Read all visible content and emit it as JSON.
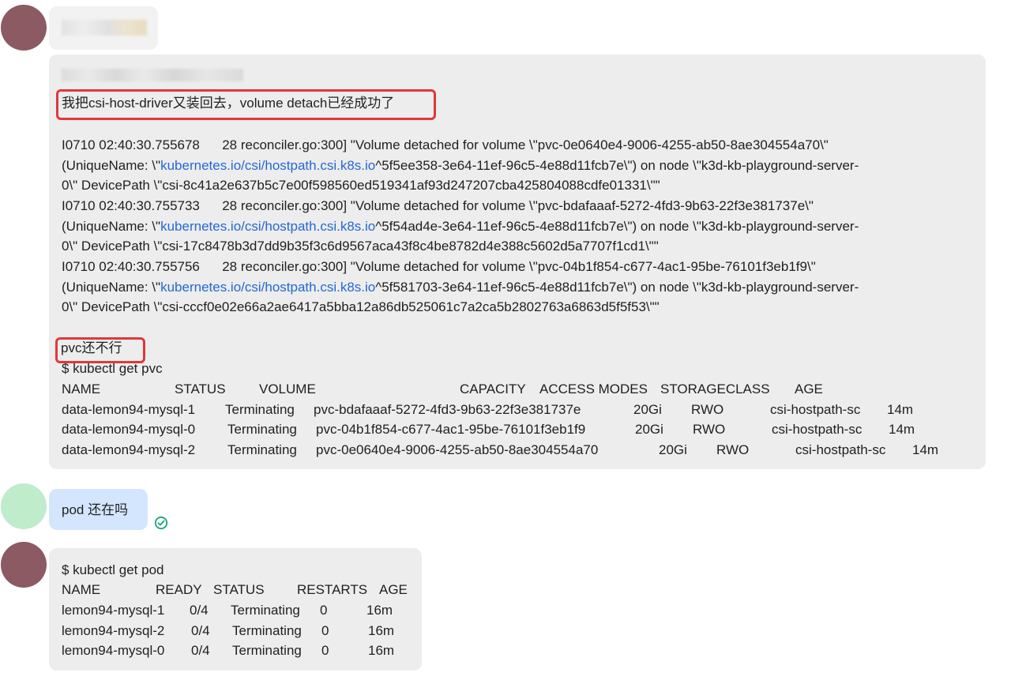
{
  "msg1": {
    "author_redacted": true
  },
  "msg2": {
    "header_redacted": true,
    "note": "我把csi-host-driver又装回去，volume detach已经成功了",
    "logs": [
      {
        "l1": "I0710 02:40:30.755678      28 reconciler.go:300] \"Volume detached for volume \\\"pvc-0e0640e4-9006-4255-ab50-8ae304554a70\\\"",
        "l2_pre": "(UniqueName: \\\"",
        "l2_link": "kubernetes.io/csi/hostpath.csi.k8s.io",
        "l2_post": "^5f5ee358-3e64-11ef-96c5-4e88d11fcb7e\\\") on node \\\"k3d-kb-playground-server-",
        "l3": "0\\\" DevicePath \\\"csi-8c41a2e637b5c7e00f598560ed519341af93d247207cba425804088cdfe01331\\\"\""
      },
      {
        "l1": "I0710 02:40:30.755733      28 reconciler.go:300] \"Volume detached for volume \\\"pvc-bdafaaaf-5272-4fd3-9b63-22f3e381737e\\\"",
        "l2_pre": "(UniqueName: \\\"",
        "l2_link": "kubernetes.io/csi/hostpath.csi.k8s.io",
        "l2_post": "^5f54ad4e-3e64-11ef-96c5-4e88d11fcb7e\\\") on node \\\"k3d-kb-playground-server-",
        "l3": "0\\\" DevicePath \\\"csi-17c8478b3d7dd9b35f3c6d9567aca43f8c4be8782d4e388c5602d5a7707f1cd1\\\"\""
      },
      {
        "l1": "I0710 02:40:30.755756      28 reconciler.go:300] \"Volume detached for volume \\\"pvc-04b1f854-c677-4ac1-95be-76101f3eb1f9\\\"",
        "l2_pre": "(UniqueName: \\\"",
        "l2_link": "kubernetes.io/csi/hostpath.csi.k8s.io",
        "l2_post": "^5f581703-3e64-11ef-96c5-4e88d11fcb7e\\\") on node \\\"k3d-kb-playground-server-",
        "l3": "0\\\" DevicePath \\\"csi-cccf0e02e66a2ae6417a5bba12a86db525061c7a2ca5b2802763a6863d5f5f53\\\"\""
      }
    ],
    "pvc_note": "pvc还不行",
    "cmd": "$ kubectl get pvc",
    "pvc_headers": [
      "NAME",
      "STATUS",
      "VOLUME",
      "CAPACITY",
      "ACCESS MODES",
      "STORAGECLASS",
      "AGE"
    ],
    "pvc_rows": [
      [
        "data-lemon94-mysql-1",
        "Terminating",
        "pvc-bdafaaaf-5272-4fd3-9b63-22f3e381737e",
        "20Gi",
        "RWO",
        "csi-hostpath-sc",
        "14m"
      ],
      [
        "data-lemon94-mysql-0",
        "Terminating",
        "pvc-04b1f854-c677-4ac1-95be-76101f3eb1f9",
        "20Gi",
        "RWO",
        "csi-hostpath-sc",
        "14m"
      ],
      [
        "data-lemon94-mysql-2",
        "Terminating",
        "pvc-0e0640e4-9006-4255-ab50-8ae304554a70",
        "20Gi",
        "RWO",
        "csi-hostpath-sc",
        "14m"
      ]
    ]
  },
  "msg3": {
    "text": "pod 还在吗",
    "read_icon": "check-circle-icon"
  },
  "msg4": {
    "cmd": "$ kubectl get pod",
    "headers": [
      "NAME",
      "READY",
      "STATUS",
      "RESTARTS",
      "AGE"
    ],
    "rows": [
      [
        "lemon94-mysql-1",
        "0/4",
        "Terminating",
        "0",
        "16m"
      ],
      [
        "lemon94-mysql-2",
        "0/4",
        "Terminating",
        "0",
        "16m"
      ],
      [
        "lemon94-mysql-0",
        "0/4",
        "Terminating",
        "0",
        "16m"
      ]
    ]
  },
  "colors": {
    "bubble_gray": "#ededed",
    "bubble_blue": "#d3e6fd",
    "avatar_maroon": "#8b5a63",
    "avatar_mint": "#bfeccb",
    "highlight_red": "#e0383b",
    "link_blue": "#2468d6",
    "check_green": "#1aa37a"
  }
}
